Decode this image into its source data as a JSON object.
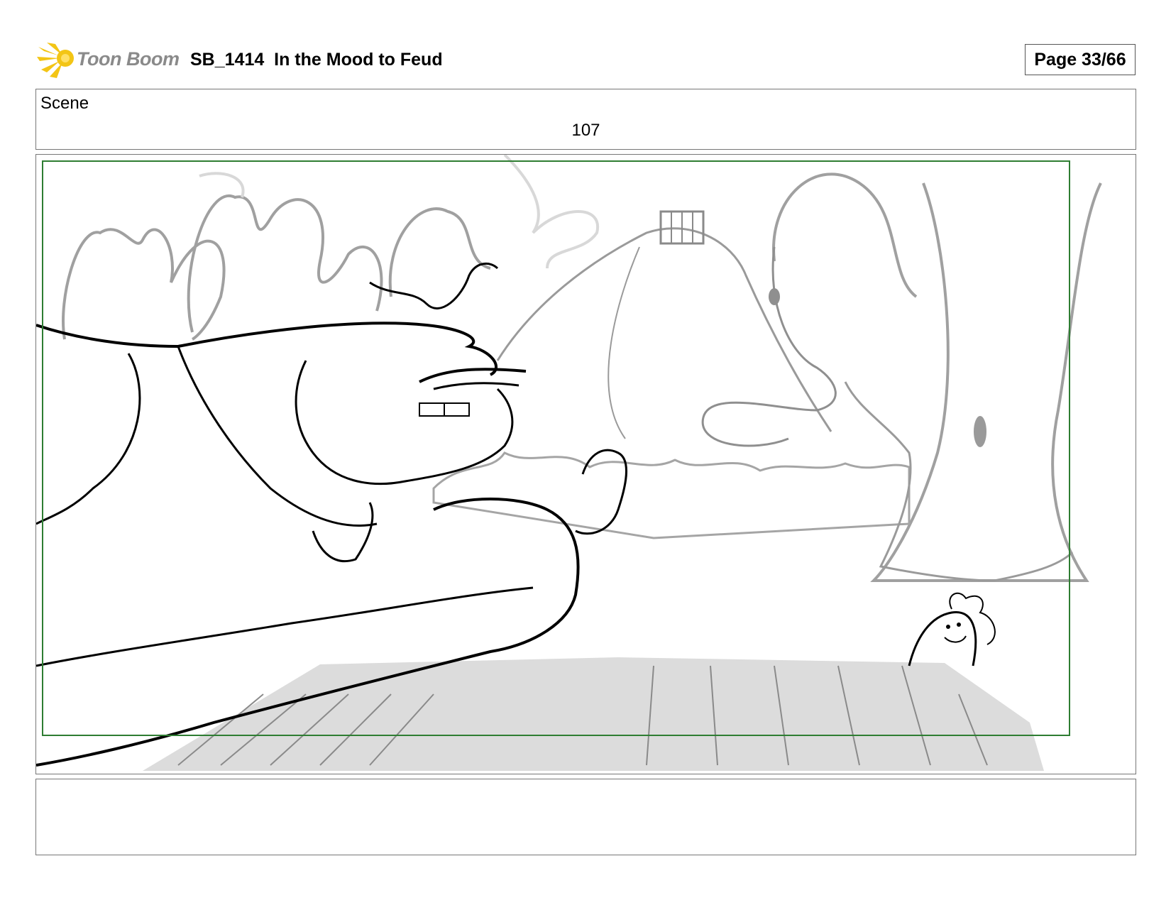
{
  "header": {
    "logo_text": "Toon Boom",
    "title": "SB_1414  In the Mood to Feud",
    "page_label": "Page 33/66"
  },
  "scene": {
    "label": "Scene",
    "number": "107"
  },
  "colors": {
    "logo_burst": "#f3c515",
    "logo_text": "#8a8a8a",
    "safe_frame": "#2e7d32",
    "sketch_gray": "#9a9a9a",
    "floor_fill": "#dcdcdc"
  },
  "notes": {
    "text": ""
  }
}
